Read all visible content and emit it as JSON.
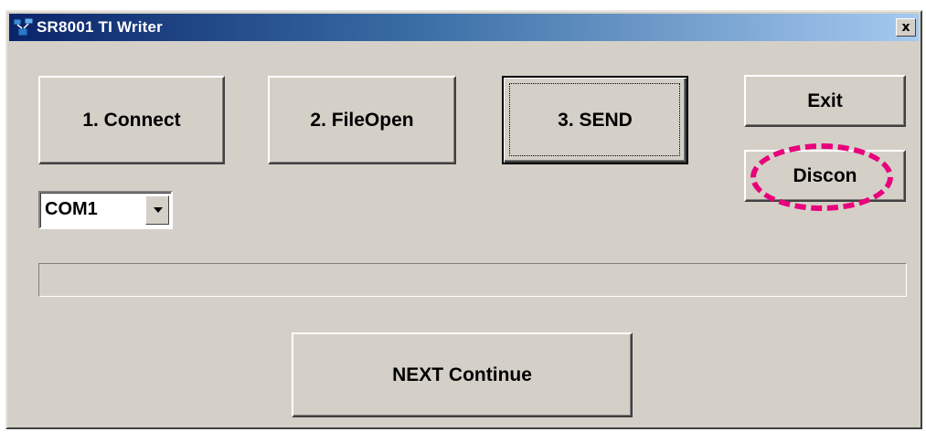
{
  "window": {
    "title": "SR8001 TI Writer",
    "close_label": "x"
  },
  "buttons": {
    "connect": "1. Connect",
    "fileopen": "2. FileOpen",
    "send": "3. SEND",
    "exit": "Exit",
    "discon": "Discon",
    "next_continue": "NEXT Continue"
  },
  "port_select": {
    "value": "COM1"
  },
  "progress": {
    "percent": 0
  },
  "annotation": {
    "color": "#e8007c",
    "target": "Discon"
  },
  "colors": {
    "window_bg": "#d4d0c8",
    "titlebar_start": "#0a246a",
    "titlebar_end": "#a6caf0"
  },
  "icons": {
    "app": "satellite-network-icon",
    "close": "close-icon",
    "dropdown": "chevron-down-icon"
  }
}
